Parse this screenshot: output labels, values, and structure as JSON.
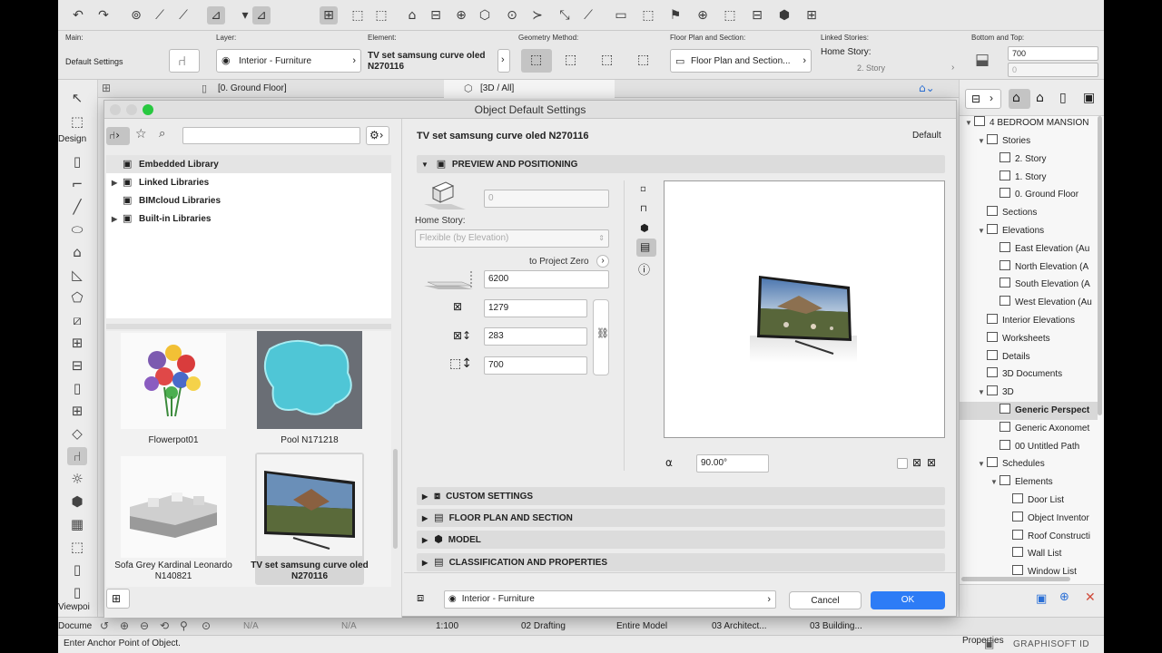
{
  "toolbar": {
    "icons": [
      "undo-icon",
      "redo-icon",
      "pick-up-icon",
      "eyedropper-icon",
      "inject-icon",
      "arrow-tool-icon",
      "marquee-icon",
      "snap-icon",
      "grid-icon",
      "layer-icon",
      "lock-icon",
      "group-icon",
      "ruler-icon",
      "measure-icon",
      "zoom-icon",
      "trim-icon",
      "split-icon",
      "elevate-icon",
      "rotate-icon",
      "mirror-icon",
      "view-icon",
      "section-icon",
      "flag-icon",
      "camera-icon",
      "render-icon",
      "shield-icon",
      "paste-icon"
    ]
  },
  "infobox": {
    "main_label": "Main:",
    "main_value": "Default Settings",
    "layer_label": "Layer:",
    "layer_value": "Interior - Furniture",
    "element_label": "Element:",
    "element_value_line1": "TV set samsung curve oled",
    "element_value_line2": "N270116",
    "geometry_label": "Geometry Method:",
    "floorplan_label": "Floor Plan and Section:",
    "floorplan_value": "Floor Plan and Section...",
    "linked_label": "Linked Stories:",
    "home_story_label": "Home Story:",
    "home_story_value": "2. Story",
    "bottom_top_label": "Bottom and Top:",
    "bottom_value": "700",
    "top_value": "0"
  },
  "tabs": {
    "floor_tab": "[0. Ground Floor]",
    "threed_tab": "[3D / All]"
  },
  "lefttools": {
    "design_label": "Design",
    "viewpoint_label": "Viewpoi",
    "document_label": "Docume"
  },
  "dialog": {
    "title": "Object Default Settings",
    "search_placeholder": "",
    "library_tree": [
      {
        "label": "Embedded Library",
        "expandable": false
      },
      {
        "label": "Linked Libraries",
        "expandable": true
      },
      {
        "label": "BIMcloud Libraries",
        "expandable": false
      },
      {
        "label": "Built-in Libraries",
        "expandable": true
      }
    ],
    "tiles": [
      {
        "caption": "Flowerpot01",
        "caption2": ""
      },
      {
        "caption": "Pool N171218",
        "caption2": ""
      },
      {
        "caption": "Sofa Grey Kardinal Leonardo",
        "caption2": "N140821"
      },
      {
        "caption": "TV set samsung curve oled",
        "caption2": "N270116"
      }
    ],
    "object_name": "TV set samsung curve oled N270116",
    "default_label": "Default",
    "preview_section": "PREVIEW AND POSITIONING",
    "elevation_value": "0",
    "home_story_label": "Home Story:",
    "home_story_value": "Flexible (by Elevation)",
    "project_zero_label": "to Project Zero",
    "project_zero_value": "6200",
    "width_value": "1279",
    "depth_value": "283",
    "height_value": "700",
    "angle_value": "90.00°",
    "sections": [
      "CUSTOM SETTINGS",
      "FLOOR PLAN AND SECTION",
      "MODEL",
      "CLASSIFICATION AND PROPERTIES"
    ],
    "layer_value": "Interior - Furniture",
    "cancel_label": "Cancel",
    "ok_label": "OK"
  },
  "navigator": {
    "project": "4 BEDROOM MANSION",
    "items": [
      {
        "label": "Stories",
        "indent": 1,
        "tri": "▼"
      },
      {
        "label": "2. Story",
        "indent": 2,
        "tri": ""
      },
      {
        "label": "1. Story",
        "indent": 2,
        "tri": ""
      },
      {
        "label": "0. Ground Floor",
        "indent": 2,
        "tri": ""
      },
      {
        "label": "Sections",
        "indent": 1,
        "tri": ""
      },
      {
        "label": "Elevations",
        "indent": 1,
        "tri": "▼"
      },
      {
        "label": "East Elevation (Au",
        "indent": 2,
        "tri": ""
      },
      {
        "label": "North Elevation (A",
        "indent": 2,
        "tri": ""
      },
      {
        "label": "South Elevation (A",
        "indent": 2,
        "tri": ""
      },
      {
        "label": "West Elevation (Au",
        "indent": 2,
        "tri": ""
      },
      {
        "label": "Interior Elevations",
        "indent": 1,
        "tri": ""
      },
      {
        "label": "Worksheets",
        "indent": 1,
        "tri": ""
      },
      {
        "label": "Details",
        "indent": 1,
        "tri": ""
      },
      {
        "label": "3D Documents",
        "indent": 1,
        "tri": ""
      },
      {
        "label": "3D",
        "indent": 1,
        "tri": "▼"
      },
      {
        "label": "Generic Perspect",
        "indent": 2,
        "tri": "",
        "selected": true
      },
      {
        "label": "Generic Axonomet",
        "indent": 2,
        "tri": ""
      },
      {
        "label": "00 Untitled Path",
        "indent": 2,
        "tri": ""
      },
      {
        "label": "Schedules",
        "indent": 1,
        "tri": "▼"
      },
      {
        "label": "Elements",
        "indent": 2,
        "tri": "▼"
      },
      {
        "label": "Door List",
        "indent": 3,
        "tri": ""
      },
      {
        "label": "Object Inventor",
        "indent": 3,
        "tri": ""
      },
      {
        "label": "Roof Constructi",
        "indent": 3,
        "tri": ""
      },
      {
        "label": "Wall List",
        "indent": 3,
        "tri": ""
      },
      {
        "label": "Window List",
        "indent": 3,
        "tri": ""
      }
    ],
    "properties_label": "Properties",
    "brand": "GRAPHISOFT ID"
  },
  "statusbar": {
    "na1": "N/A",
    "na2": "N/A",
    "scale": "1:100",
    "pen": "02 Drafting",
    "model": "Entire Model",
    "arch": "03 Architect...",
    "building": "03 Building..."
  },
  "prompt": "Enter Anchor Point of Object."
}
